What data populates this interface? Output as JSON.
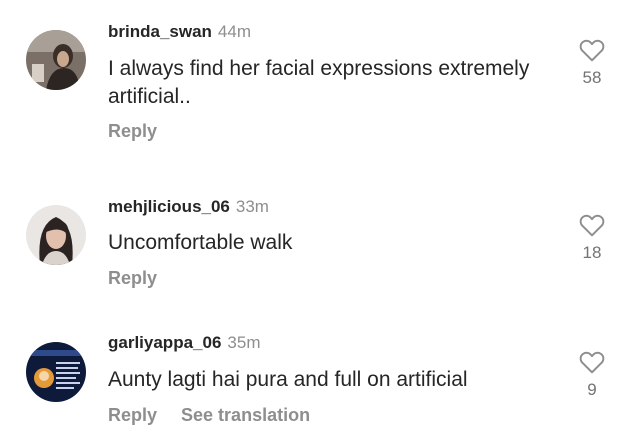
{
  "comments": [
    {
      "username": "brinda_swan",
      "time": "44m",
      "text": "I always find her facial expressions extremely artificial..",
      "reply": "Reply",
      "likes": "58"
    },
    {
      "username": "mehjlicious_06",
      "time": "33m",
      "text": "Uncomfortable walk",
      "reply": "Reply",
      "likes": "18"
    },
    {
      "username": "garliyappa_06",
      "time": "35m",
      "text": "Aunty lagti hai pura and full on artificial",
      "reply": "Reply",
      "see_translation": "See translation",
      "likes": "9"
    }
  ],
  "icons": {
    "like": "heart-outline-icon"
  },
  "colors": {
    "text": "#262626",
    "muted": "#8e8e8e"
  }
}
